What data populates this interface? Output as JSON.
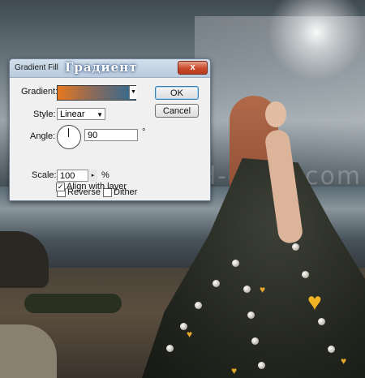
{
  "dialog": {
    "title": "Gradient Fill",
    "overlay_title": "Градиент",
    "close_label": "x",
    "gradient_label": "Gradient:",
    "gradient_colors": [
      "#e7781f",
      "#2c6a95"
    ],
    "style_label": "Style:",
    "style_value": "Linear",
    "angle_label": "Angle:",
    "angle_value": "90",
    "angle_unit": "°",
    "scale_label": "Scale:",
    "scale_value": "100",
    "scale_unit": "%",
    "reverse_label": "Reverse",
    "reverse_checked": false,
    "dither_label": "Dither",
    "dither_checked": false,
    "align_label": "Align with layer",
    "align_checked": true,
    "ok_label": "OK",
    "cancel_label": "Cancel"
  },
  "watermark": {
    "text": "www.psd-dude.com"
  }
}
